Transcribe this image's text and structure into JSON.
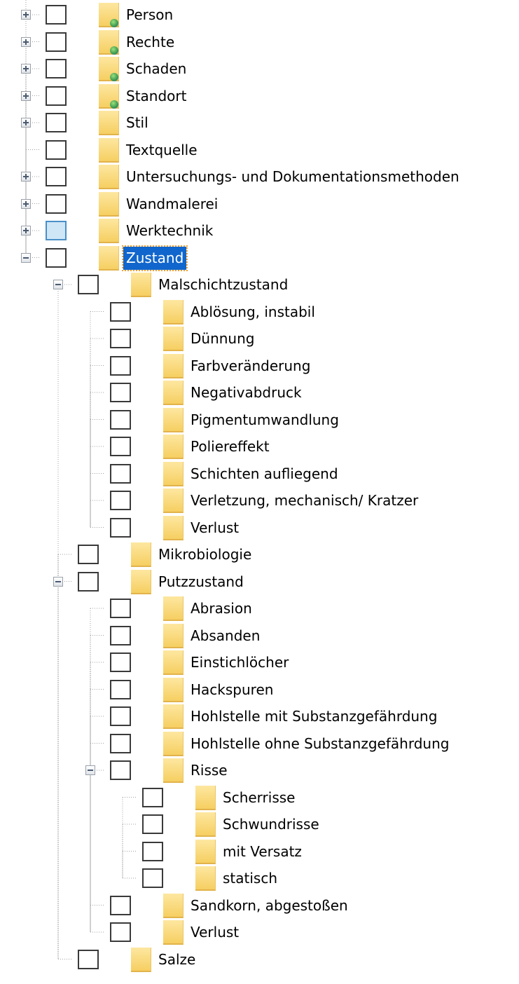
{
  "tree": {
    "nodes": [
      {
        "label": "Person",
        "level": 0,
        "toggle": "plus",
        "icon": "web-folder-icon",
        "line": "tee"
      },
      {
        "label": "Rechte",
        "level": 0,
        "toggle": "plus",
        "icon": "web-folder-icon",
        "line": "tee"
      },
      {
        "label": "Schaden",
        "level": 0,
        "toggle": "plus",
        "icon": "web-folder-icon",
        "line": "tee"
      },
      {
        "label": "Standort",
        "level": 0,
        "toggle": "plus",
        "icon": "web-folder-icon",
        "line": "tee"
      },
      {
        "label": "Stil",
        "level": 0,
        "toggle": "plus",
        "icon": "folder-icon",
        "line": "tee"
      },
      {
        "label": "Textquelle",
        "level": 0,
        "toggle": "none",
        "icon": "folder-icon",
        "line": "tee"
      },
      {
        "label": "Untersuchungs- und Dokumentationsmethoden",
        "level": 0,
        "toggle": "plus",
        "icon": "folder-icon",
        "line": "tee"
      },
      {
        "label": "Wandmalerei",
        "level": 0,
        "toggle": "plus",
        "icon": "folder-icon",
        "line": "tee"
      },
      {
        "label": "Werktechnik",
        "level": 0,
        "toggle": "plus",
        "icon": "folder-icon",
        "line": "tee",
        "check": "highlighted"
      },
      {
        "label": "Zustand",
        "level": 0,
        "toggle": "minus",
        "icon": "folder-icon",
        "line": "last",
        "selected": true
      },
      {
        "label": "Malschichtzustand",
        "level": 1,
        "toggle": "minus",
        "icon": "folder-icon",
        "line": "tee"
      },
      {
        "label": "Ablösung, instabil",
        "level": 2,
        "toggle": "none",
        "icon": "folder-icon",
        "line": "tee"
      },
      {
        "label": "Dünnung",
        "level": 2,
        "toggle": "none",
        "icon": "folder-icon",
        "line": "tee"
      },
      {
        "label": "Farbveränderung",
        "level": 2,
        "toggle": "none",
        "icon": "folder-icon",
        "line": "tee"
      },
      {
        "label": "Negativabdruck",
        "level": 2,
        "toggle": "none",
        "icon": "folder-icon",
        "line": "tee"
      },
      {
        "label": "Pigmentumwandlung",
        "level": 2,
        "toggle": "none",
        "icon": "folder-icon",
        "line": "tee"
      },
      {
        "label": "Poliereffekt",
        "level": 2,
        "toggle": "none",
        "icon": "folder-icon",
        "line": "tee"
      },
      {
        "label": "Schichten aufliegend",
        "level": 2,
        "toggle": "none",
        "icon": "folder-icon",
        "line": "tee"
      },
      {
        "label": "Verletzung, mechanisch/ Kratzer",
        "level": 2,
        "toggle": "none",
        "icon": "folder-icon",
        "line": "tee"
      },
      {
        "label": "Verlust",
        "level": 2,
        "toggle": "none",
        "icon": "folder-icon",
        "line": "last"
      },
      {
        "label": "Mikrobiologie",
        "level": 1,
        "toggle": "none",
        "icon": "folder-icon",
        "line": "tee"
      },
      {
        "label": "Putzzustand",
        "level": 1,
        "toggle": "minus",
        "icon": "folder-icon",
        "line": "tee"
      },
      {
        "label": "Abrasion",
        "level": 2,
        "toggle": "none",
        "icon": "folder-icon",
        "line": "tee"
      },
      {
        "label": "Absanden",
        "level": 2,
        "toggle": "none",
        "icon": "folder-icon",
        "line": "tee"
      },
      {
        "label": "Einstichlöcher",
        "level": 2,
        "toggle": "none",
        "icon": "folder-icon",
        "line": "tee"
      },
      {
        "label": "Hackspuren",
        "level": 2,
        "toggle": "none",
        "icon": "folder-icon",
        "line": "tee"
      },
      {
        "label": "Hohlstelle mit Substanzgefährdung",
        "level": 2,
        "toggle": "none",
        "icon": "folder-icon",
        "line": "tee"
      },
      {
        "label": "Hohlstelle ohne Substanzgefährdung",
        "level": 2,
        "toggle": "none",
        "icon": "folder-icon",
        "line": "tee"
      },
      {
        "label": "Risse",
        "level": 2,
        "toggle": "minus",
        "icon": "folder-icon",
        "line": "tee"
      },
      {
        "label": "Scherrisse",
        "level": 3,
        "toggle": "none",
        "icon": "folder-icon",
        "line": "tee"
      },
      {
        "label": "Schwundrisse",
        "level": 3,
        "toggle": "none",
        "icon": "folder-icon",
        "line": "tee"
      },
      {
        "label": "mit Versatz",
        "level": 3,
        "toggle": "none",
        "icon": "folder-icon",
        "line": "tee"
      },
      {
        "label": "statisch",
        "level": 3,
        "toggle": "none",
        "icon": "folder-icon",
        "line": "last"
      },
      {
        "label": "Sandkorn, abgestoßen",
        "level": 2,
        "toggle": "none",
        "icon": "folder-icon",
        "line": "tee"
      },
      {
        "label": "Verlust",
        "level": 2,
        "toggle": "none",
        "icon": "folder-icon",
        "line": "last"
      },
      {
        "label": "Salze",
        "level": 1,
        "toggle": "none",
        "icon": "folder-icon",
        "line": "last"
      }
    ]
  },
  "colors": {
    "folder": "#f6cf62",
    "selection": "#1066cc",
    "highlight_check": "#cfe6f7",
    "tree_line": "#a0a0a0"
  }
}
